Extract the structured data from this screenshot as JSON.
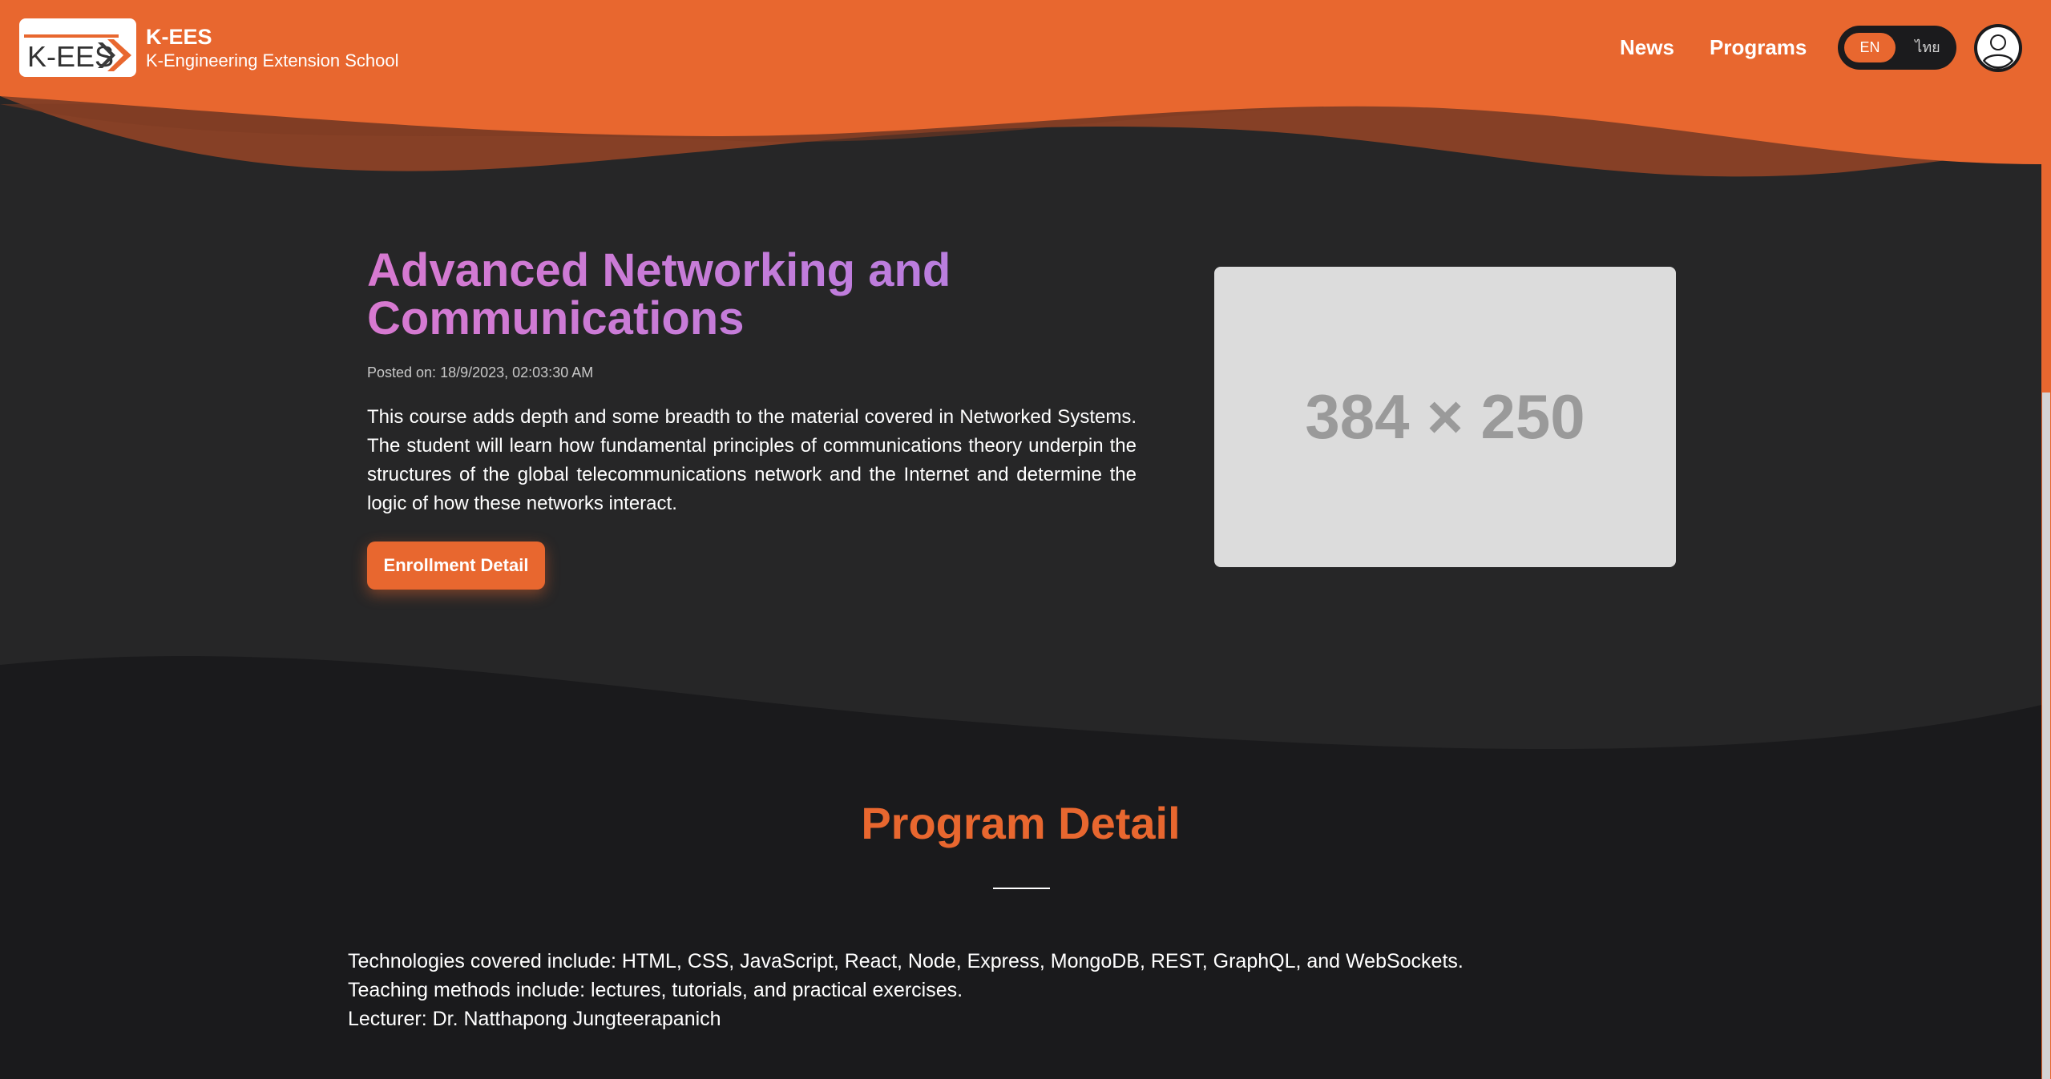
{
  "header": {
    "logo_text": "K-EES",
    "logo_tagline": "K-Engineering Extension School",
    "brand_name": "K-EES",
    "brand_subtitle": "K-Engineering Extension School",
    "nav": [
      {
        "label": "News"
      },
      {
        "label": "Programs"
      }
    ],
    "language": {
      "options": [
        "EN",
        "ไทย"
      ],
      "selected": "EN"
    },
    "user_icon": "user-icon"
  },
  "hero": {
    "title": "Advanced Networking and Communications",
    "posted": "Posted on: 18/9/2023, 02:03:30 AM",
    "description": "This course adds depth and some breadth to the material covered in Networked Systems. The student will learn how fundamental principles of communications theory underpin the structures of the global telecommunications network and the Internet and determine the logic of how these networks interact.",
    "enroll_label": "Enrollment Detail",
    "image_placeholder": "384 × 250"
  },
  "program_detail": {
    "heading": "Program Detail",
    "lines": [
      "Technologies covered include: HTML, CSS, JavaScript, React, Node, Express, MongoDB, REST, GraphQL, and WebSockets.",
      "Teaching methods include: lectures, tutorials, and practical exercises.",
      "Lecturer: Dr. Natthapong Jungteerapanich"
    ]
  },
  "colors": {
    "accent": "#e8672f",
    "hero_bg": "#262627",
    "page_bg": "#1a1a1c",
    "title_gradient_start": "#d779d0",
    "title_gradient_end": "#b77ee0"
  }
}
